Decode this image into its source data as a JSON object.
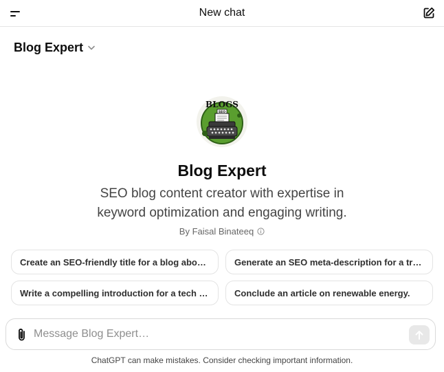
{
  "header": {
    "title": "New chat",
    "menu_icon": "menu-icon",
    "new_chat_icon": "compose-icon"
  },
  "model_selector": {
    "label": "Blog Expert",
    "icon": "chevron-down-icon"
  },
  "gpt": {
    "logo_icon": "blogs-typewriter-logo",
    "name": "Blog Expert",
    "description": "SEO blog content creator with expertise in keyword optimization and engaging writing.",
    "author": "By Faisal Binateeq",
    "info_icon": "info-icon"
  },
  "suggestions": [
    {
      "label": "Create an SEO-friendly title for a blog about sustainable living."
    },
    {
      "label": "Generate an SEO meta-description for a travel blog post."
    },
    {
      "label": "Write a compelling introduction for a tech article."
    },
    {
      "label": "Conclude an article on renewable energy."
    }
  ],
  "composer": {
    "placeholder": "Message Blog Expert…",
    "value": "",
    "attach_icon": "paperclip-icon",
    "send_icon": "arrow-up-icon"
  },
  "footer": {
    "disclaimer": "ChatGPT can make mistakes. Consider checking important information."
  },
  "colors": {
    "logo_green": "#5a9e2f",
    "border": "#e3e3e3",
    "send_bg": "#e8e8e8"
  }
}
